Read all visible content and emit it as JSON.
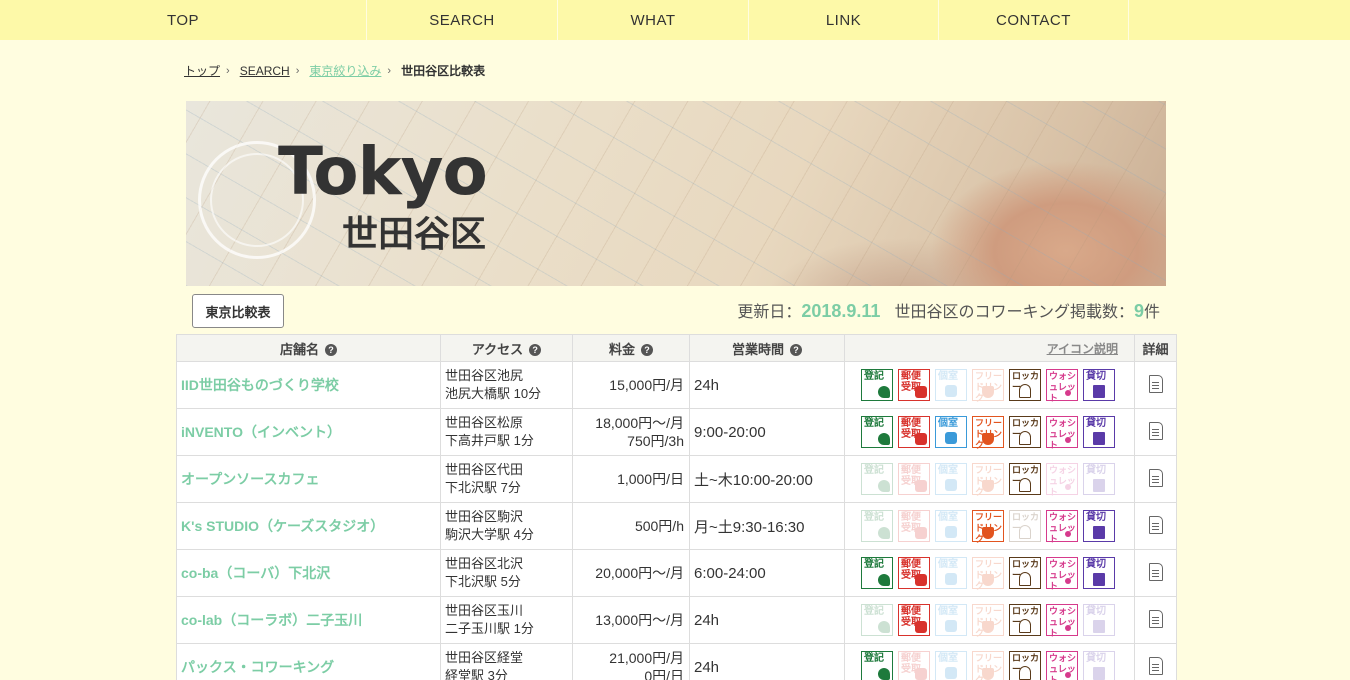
{
  "nav": [
    "TOP",
    "SEARCH",
    "WHAT",
    "LINK",
    "CONTACT"
  ],
  "breadcrumb": {
    "top": "トップ",
    "search": "SEARCH",
    "tokyo": "東京絞り込み",
    "current": "世田谷区比較表"
  },
  "hero": {
    "title": "Tokyo",
    "subtitle": "世田谷区"
  },
  "compare_button": "東京比較表",
  "summary": {
    "updated_label": "更新日：",
    "updated_date": "2018.9.11",
    "count_label": "世田谷区のコワーキング掲載数：",
    "count": "9",
    "count_unit": "件"
  },
  "table": {
    "headers": {
      "name": "店舗名",
      "access": "アクセス",
      "price": "料金",
      "hours": "営業時間",
      "icons": "アイコン説明",
      "detail": "詳細"
    },
    "icon_labels": {
      "toroku": "登記",
      "yubin": "郵便受取",
      "koshitsu": "個室",
      "drink": "フリードリンク",
      "locker": "ロッカー",
      "washlet": "ウォシュレット",
      "kashikiri": "貸切"
    },
    "rows": [
      {
        "name": "IID世田谷ものづくり学校",
        "access1": "世田谷区池尻",
        "access2": "池尻大橋駅 10分",
        "price1": "15,000円/月",
        "price2": "",
        "hours": "24h",
        "icons": {
          "toroku": true,
          "yubin": true,
          "koshitsu": false,
          "drink": false,
          "locker": true,
          "washlet": true,
          "kashikiri": true
        }
      },
      {
        "name": "iNVENTO（インベント）",
        "access1": "世田谷区松原",
        "access2": "下高井戸駅 1分",
        "price1": "18,000円〜/月",
        "price2": "750円/3h",
        "hours": "9:00-20:00",
        "icons": {
          "toroku": true,
          "yubin": true,
          "koshitsu": true,
          "drink": true,
          "locker": true,
          "washlet": true,
          "kashikiri": true
        }
      },
      {
        "name": "オープンソースカフェ",
        "access1": "世田谷区代田",
        "access2": "下北沢駅 7分",
        "price1": "1,000円/日",
        "price2": "",
        "hours": "土~木10:00-20:00",
        "icons": {
          "toroku": false,
          "yubin": false,
          "koshitsu": false,
          "drink": false,
          "locker": true,
          "washlet": false,
          "kashikiri": false
        }
      },
      {
        "name": "K's STUDIO（ケーズスタジオ）",
        "access1": "世田谷区駒沢",
        "access2": "駒沢大学駅 4分",
        "price1": "500円/h",
        "price2": "",
        "hours": "月~土9:30-16:30",
        "icons": {
          "toroku": false,
          "yubin": false,
          "koshitsu": false,
          "drink": true,
          "locker": false,
          "washlet": true,
          "kashikiri": true
        }
      },
      {
        "name": "co-ba（コーバ）下北沢",
        "access1": "世田谷区北沢",
        "access2": "下北沢駅 5分",
        "price1": "20,000円〜/月",
        "price2": "",
        "hours": "6:00-24:00",
        "icons": {
          "toroku": true,
          "yubin": true,
          "koshitsu": false,
          "drink": false,
          "locker": true,
          "washlet": true,
          "kashikiri": true
        }
      },
      {
        "name": "co-lab（コーラボ）二子玉川",
        "access1": "世田谷区玉川",
        "access2": "二子玉川駅 1分",
        "price1": "13,000円〜/月",
        "price2": "",
        "hours": "24h",
        "icons": {
          "toroku": false,
          "yubin": true,
          "koshitsu": false,
          "drink": false,
          "locker": true,
          "washlet": true,
          "kashikiri": false
        }
      },
      {
        "name": "パックス・コワーキング",
        "access1": "世田谷区経堂",
        "access2": "経堂駅 3分",
        "price1": "21,000円/月",
        "price2": "0円/日",
        "hours": "24h",
        "icons": {
          "toroku": true,
          "yubin": false,
          "koshitsu": false,
          "drink": false,
          "locker": true,
          "washlet": true,
          "kashikiri": false
        }
      }
    ]
  }
}
